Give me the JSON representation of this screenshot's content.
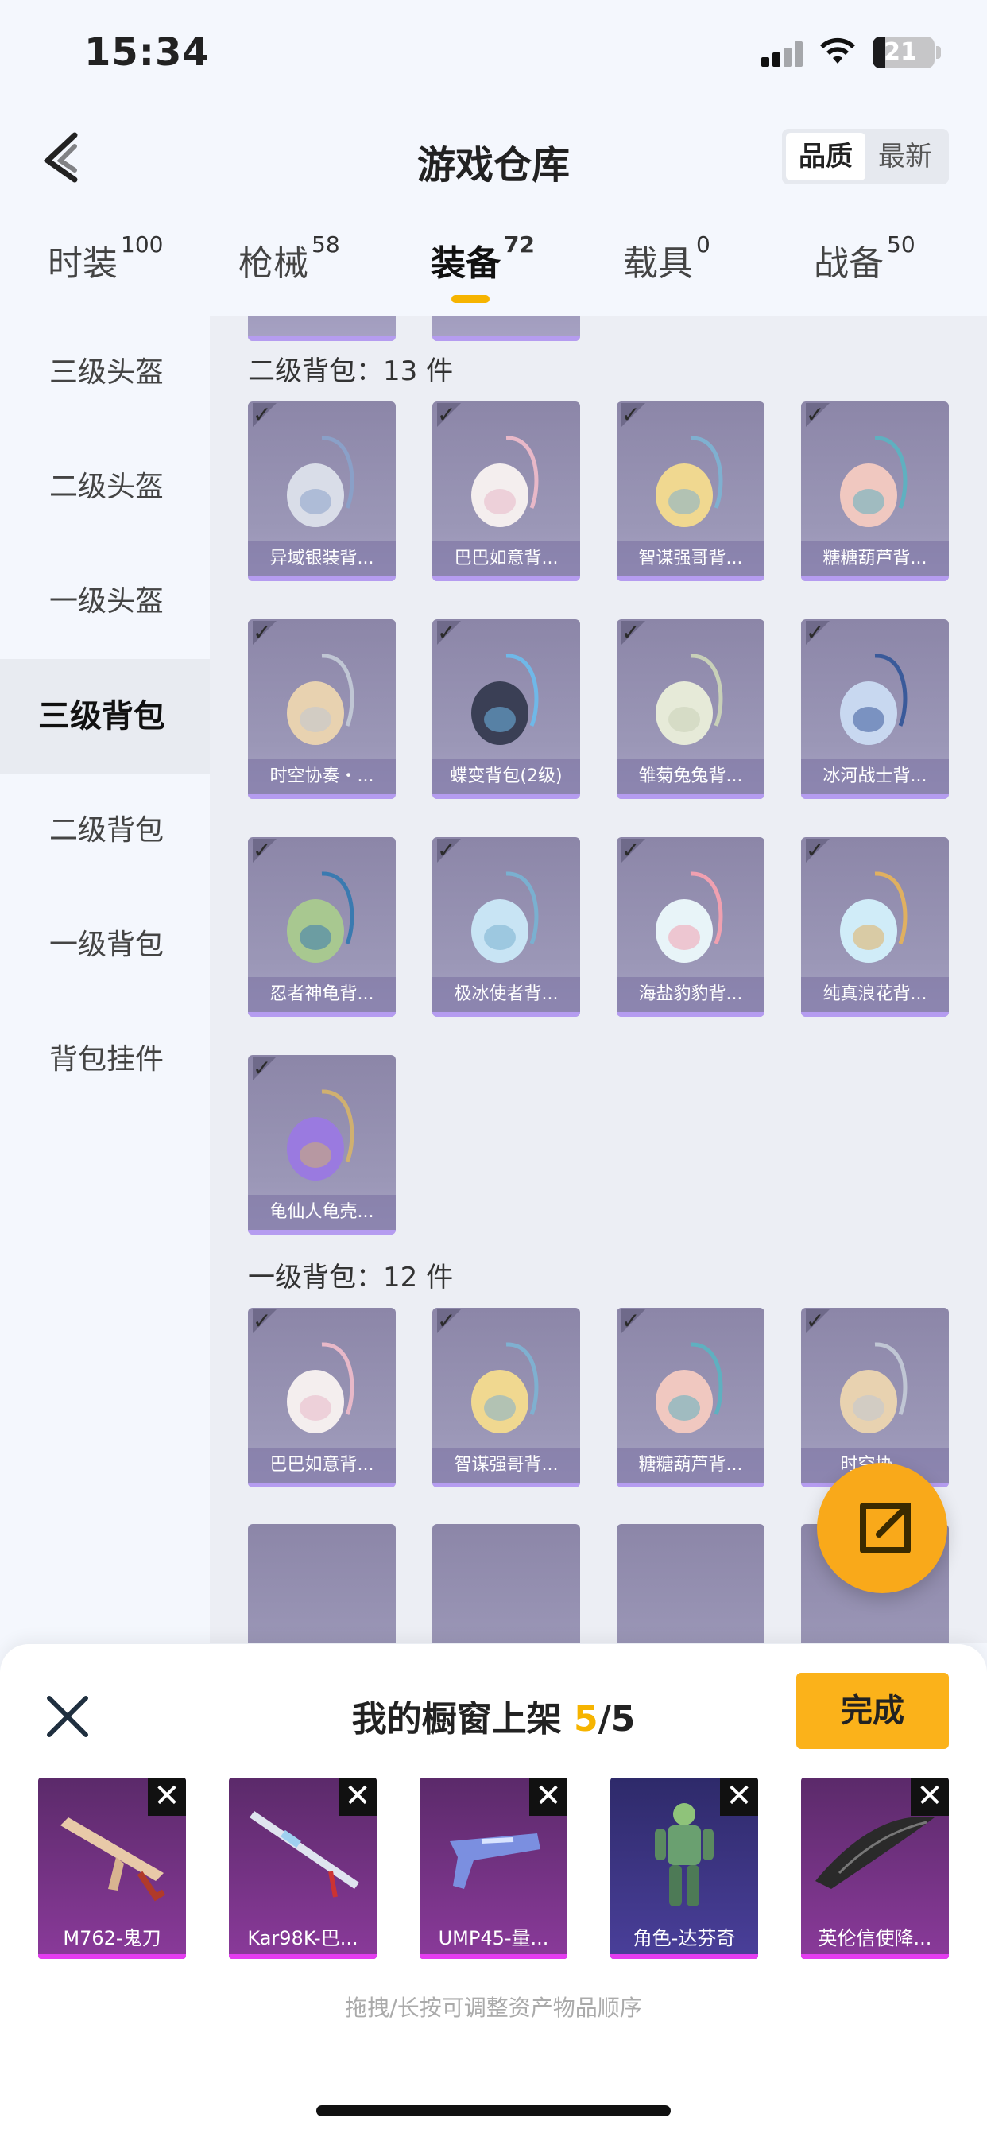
{
  "status_bar": {
    "time": "15:34",
    "battery": "21",
    "battery_level": 0.21
  },
  "header": {
    "title": "游戏仓库",
    "sort_options": [
      "品质",
      "最新"
    ]
  },
  "tabs": [
    {
      "label": "时装",
      "count": "100"
    },
    {
      "label": "枪械",
      "count": "58"
    },
    {
      "label": "装备",
      "count": "72"
    },
    {
      "label": "载具",
      "count": "0"
    },
    {
      "label": "战备",
      "count": "50"
    }
  ],
  "sidebar": {
    "items": [
      "三级头盔",
      "二级头盔",
      "一级头盔",
      "三级背包",
      "二级背包",
      "一级背包",
      "背包挂件"
    ]
  },
  "sections": [
    {
      "title": "二级背包：13 件",
      "items": [
        "异域银装背...",
        "巴巴如意背...",
        "智谋强哥背...",
        "糖糖葫芦背...",
        "时空协奏・...",
        "蝶变背包(2级)",
        "雏菊兔兔背...",
        "冰河战士背...",
        "忍者神龟背...",
        "极冰使者背...",
        "海盐豹豹背...",
        "纯真浪花背...",
        "龟仙人龟壳..."
      ]
    },
    {
      "title": "一级背包：12 件",
      "items": [
        "巴巴如意背...",
        "智谋强哥背...",
        "糖糖葫芦背...",
        "时空协..."
      ]
    }
  ],
  "sheet": {
    "title_prefix": "我的橱窗上架",
    "count": "5",
    "total": "/5",
    "done_label": "完成",
    "close_symbol": "✕",
    "remove_symbol": "✕",
    "items": [
      "M762-鬼刀",
      "Kar98K-巴...",
      "UMP45-量...",
      "角色-达芬奇",
      "英伦信使降..."
    ],
    "hint": "拖拽/长按可调整资产物品顺序"
  },
  "colors": {
    "accent": "#f6b400",
    "done_button": "#fbb21a",
    "card": "#9b97b7",
    "shelf_purple": "#7a2a8a"
  }
}
